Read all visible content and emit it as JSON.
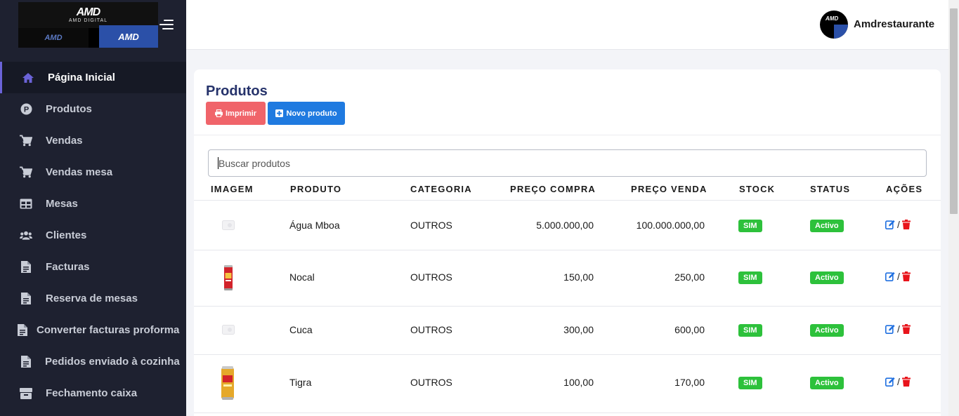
{
  "brand": {
    "logo_mark": "AMD",
    "logo_sub": "AMD DIGITAL",
    "logo_left": "AMD",
    "logo_right": "AMD"
  },
  "sidebar": {
    "items": [
      {
        "label": "Página Inicial",
        "icon": "home-icon"
      },
      {
        "label": "Produtos",
        "icon": "product-icon"
      },
      {
        "label": "Vendas",
        "icon": "cart-icon"
      },
      {
        "label": "Vendas mesa",
        "icon": "cart-icon"
      },
      {
        "label": "Mesas",
        "icon": "table-icon"
      },
      {
        "label": "Clientes",
        "icon": "users-icon"
      },
      {
        "label": "Facturas",
        "icon": "document-icon"
      },
      {
        "label": "Reserva de mesas",
        "icon": "document-icon"
      },
      {
        "label": "Converter facturas proforma",
        "icon": "document-icon"
      },
      {
        "label": "Pedidos enviado à cozinha",
        "icon": "document-icon"
      },
      {
        "label": "Fechamento caixa",
        "icon": "box-icon"
      }
    ]
  },
  "header": {
    "username": "Amdrestaurante",
    "avatar_text": "AMD"
  },
  "main": {
    "title": "Produtos",
    "print_label": "Imprimir",
    "new_label": "Novo produto",
    "search_placeholder": "Buscar produtos",
    "columns": [
      "IMAGEM",
      "PRODUTO",
      "CATEGORIA",
      "PREÇO COMPRA",
      "PREÇO VENDA",
      "STOCK",
      "STATUS",
      "AÇÕES"
    ],
    "rows": [
      {
        "image": "placeholder",
        "produto": "Água Mboa",
        "categoria": "OUTROS",
        "preco_compra": "5.000.000,00",
        "preco_venda": "100.000.000,00",
        "stock": "SIM",
        "status": "Activo",
        "sep": "/"
      },
      {
        "image": "red-can",
        "produto": "Nocal",
        "categoria": "OUTROS",
        "preco_compra": "150,00",
        "preco_venda": "250,00",
        "stock": "SIM",
        "status": "Activo",
        "sep": "/"
      },
      {
        "image": "placeholder",
        "produto": "Cuca",
        "categoria": "OUTROS",
        "preco_compra": "300,00",
        "preco_venda": "600,00",
        "stock": "SIM",
        "status": "Activo",
        "sep": "/"
      },
      {
        "image": "gold-can",
        "produto": "Tigra",
        "categoria": "OUTROS",
        "preco_compra": "100,00",
        "preco_venda": "170,00",
        "stock": "SIM",
        "status": "Activo",
        "sep": "/"
      }
    ]
  },
  "colors": {
    "sidebar_bg": "#1e2130",
    "active_accent": "#6b63d8",
    "title": "#26336b",
    "print_button": "#f0646a",
    "new_button": "#1f7ae0",
    "badge": "#2dc13b",
    "edit_icon": "#1f6fe0",
    "delete_icon": "#e8141b"
  }
}
